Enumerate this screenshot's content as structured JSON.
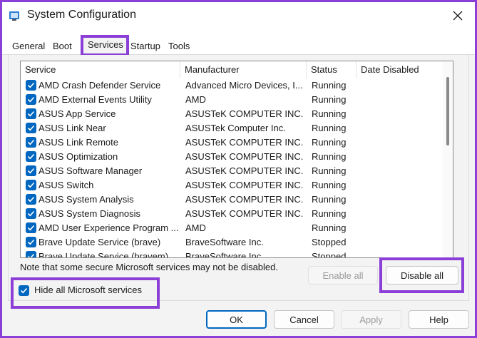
{
  "window": {
    "title": "System Configuration"
  },
  "tabs": [
    {
      "label": "General"
    },
    {
      "label": "Boot"
    },
    {
      "label": "Services"
    },
    {
      "label": "Startup"
    },
    {
      "label": "Tools"
    }
  ],
  "table": {
    "columns": [
      "Service",
      "Manufacturer",
      "Status",
      "Date Disabled"
    ],
    "rows": [
      {
        "service": "AMD Crash Defender Service",
        "manufacturer": "Advanced Micro Devices, I...",
        "status": "Running",
        "date_disabled": ""
      },
      {
        "service": "AMD External Events Utility",
        "manufacturer": "AMD",
        "status": "Running",
        "date_disabled": ""
      },
      {
        "service": "ASUS App Service",
        "manufacturer": "ASUSTeK COMPUTER INC.",
        "status": "Running",
        "date_disabled": ""
      },
      {
        "service": "ASUS Link Near",
        "manufacturer": "ASUSTek Computer Inc.",
        "status": "Running",
        "date_disabled": ""
      },
      {
        "service": "ASUS Link Remote",
        "manufacturer": "ASUSTeK COMPUTER INC.",
        "status": "Running",
        "date_disabled": ""
      },
      {
        "service": "ASUS Optimization",
        "manufacturer": "ASUSTeK COMPUTER INC.",
        "status": "Running",
        "date_disabled": ""
      },
      {
        "service": "ASUS Software Manager",
        "manufacturer": "ASUSTeK COMPUTER INC.",
        "status": "Running",
        "date_disabled": ""
      },
      {
        "service": "ASUS Switch",
        "manufacturer": "ASUSTeK COMPUTER INC.",
        "status": "Running",
        "date_disabled": ""
      },
      {
        "service": "ASUS System Analysis",
        "manufacturer": "ASUSTeK COMPUTER INC.",
        "status": "Running",
        "date_disabled": ""
      },
      {
        "service": "ASUS System Diagnosis",
        "manufacturer": "ASUSTeK COMPUTER INC.",
        "status": "Running",
        "date_disabled": ""
      },
      {
        "service": "AMD User Experience Program ...",
        "manufacturer": "AMD",
        "status": "Running",
        "date_disabled": ""
      },
      {
        "service": "Brave Update Service (brave)",
        "manufacturer": "BraveSoftware Inc.",
        "status": "Stopped",
        "date_disabled": ""
      },
      {
        "service": "Brave Update Service (bravem)",
        "manufacturer": "BraveSoftware Inc.",
        "status": "Stopped",
        "date_disabled": ""
      }
    ]
  },
  "note": "Note that some secure Microsoft services may not be disabled.",
  "buttons": {
    "enable_all": "Enable all",
    "disable_all": "Disable all",
    "ok": "OK",
    "cancel": "Cancel",
    "apply": "Apply",
    "help": "Help"
  },
  "hide_ms": {
    "label": "Hide all Microsoft services",
    "checked": true
  },
  "colors": {
    "highlight": "#8b3fd6",
    "accent": "#0067c0"
  }
}
